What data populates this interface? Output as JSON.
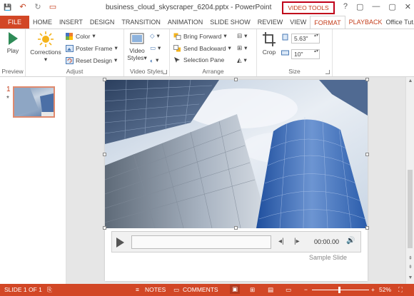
{
  "window": {
    "title": "business_cloud_skyscraper_6204.pptx - PowerPoint",
    "contextual_group": "VIDEO TOOLS",
    "controls": {
      "help": "?",
      "restore": "▢",
      "minimize": "—",
      "close": "✕"
    }
  },
  "quick_access": {
    "save": "💾",
    "undo": "↶",
    "redo": "↻",
    "present": "▭"
  },
  "tabs": [
    "FILE",
    "HOME",
    "INSERT",
    "DESIGN",
    "TRANSITION",
    "ANIMATION",
    "SLIDE SHOW",
    "REVIEW",
    "VIEW",
    "FORMAT",
    "PLAYBACK"
  ],
  "user": "Office Tut...",
  "ribbon": {
    "preview": {
      "label": "Preview",
      "play": "Play"
    },
    "adjust": {
      "label": "Adjust",
      "corrections": "Corrections",
      "color": "Color",
      "poster_frame": "Poster Frame",
      "reset_design": "Reset Design"
    },
    "video_styles": {
      "label": "Video Styles",
      "styles": "Video Styles"
    },
    "arrange": {
      "label": "Arrange",
      "bring_forward": "Bring Forward",
      "send_backward": "Send Backward",
      "selection_pane": "Selection Pane"
    },
    "size": {
      "label": "Size",
      "crop": "Crop",
      "height": "5.63\"",
      "width": "10\""
    }
  },
  "thumbnails": {
    "number": "1",
    "marker": "*"
  },
  "slide": {
    "player": {
      "time": "00:00.00"
    },
    "caption": "Sample Slide"
  },
  "status": {
    "slide_info": "SLIDE 1 OF 1",
    "notes": "NOTES",
    "comments": "COMMENTS",
    "zoom": "52%"
  },
  "colors": {
    "accent": "#d24726",
    "highlight_border": "#c0001a"
  }
}
